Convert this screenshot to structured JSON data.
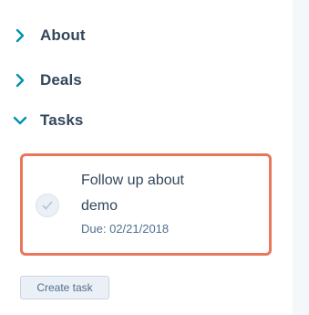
{
  "sections": {
    "about": {
      "label": "About",
      "expanded": false,
      "icon": "chevron-right-icon"
    },
    "deals": {
      "label": "Deals",
      "expanded": false,
      "icon": "chevron-right-icon"
    },
    "tasks": {
      "label": "Tasks",
      "expanded": true,
      "icon": "chevron-down-icon"
    }
  },
  "task": {
    "title": "Follow up about demo",
    "due": "Due: 02/21/2018",
    "completed": false,
    "icon": "checkmark-icon"
  },
  "buttons": {
    "create_task": "Create task"
  },
  "colors": {
    "accent": "#0091ae",
    "highlight_border": "#e8775c",
    "text": "#33475b",
    "rail": "#f5f8fa"
  }
}
